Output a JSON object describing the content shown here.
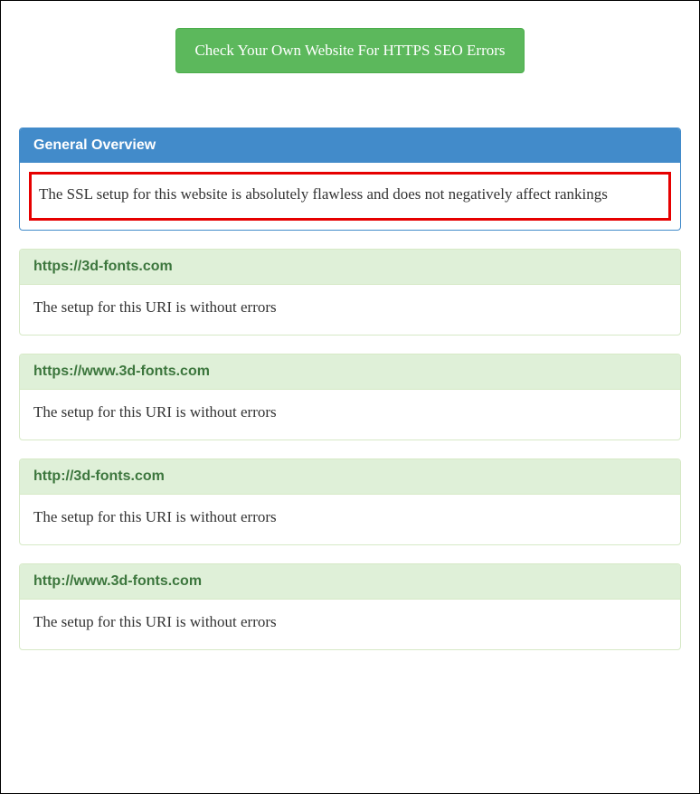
{
  "cta": {
    "label": "Check Your Own Website For HTTPS SEO Errors"
  },
  "overview": {
    "heading": "General Overview",
    "summary": "The SSL setup for this website is absolutely flawless and does not negatively affect rankings"
  },
  "uris": [
    {
      "url": "https://3d-fonts.com",
      "status": "The setup for this URI is without errors"
    },
    {
      "url": "https://www.3d-fonts.com",
      "status": "The setup for this URI is without errors"
    },
    {
      "url": "http://3d-fonts.com",
      "status": "The setup for this URI is without errors"
    },
    {
      "url": "http://www.3d-fonts.com",
      "status": "The setup for this URI is without errors"
    }
  ]
}
